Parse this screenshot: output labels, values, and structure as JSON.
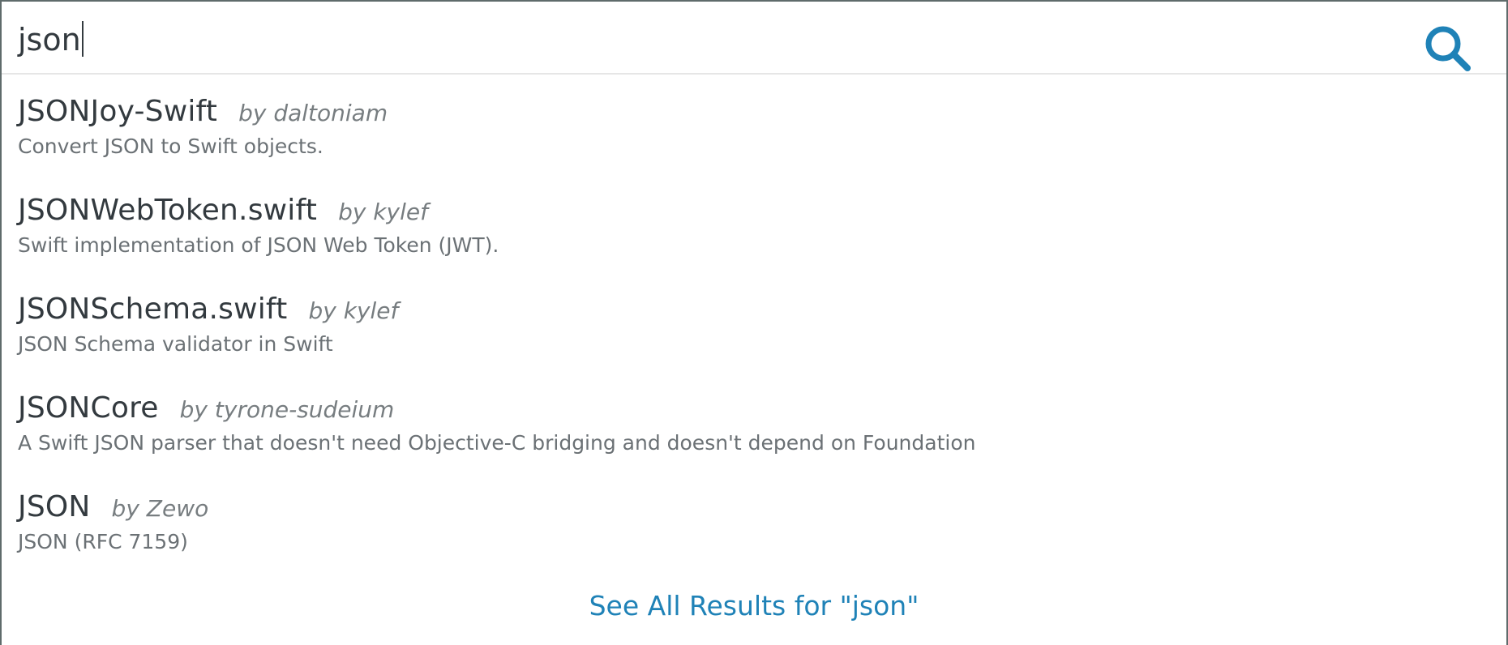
{
  "search": {
    "query": "json",
    "accent_color": "#1f82b7"
  },
  "results": [
    {
      "name": "JSONJoy-Swift",
      "author": "by daltoniam",
      "description": "Convert JSON to Swift objects."
    },
    {
      "name": "JSONWebToken.swift",
      "author": "by kylef",
      "description": "Swift implementation of JSON Web Token (JWT)."
    },
    {
      "name": "JSONSchema.swift",
      "author": "by kylef",
      "description": "JSON Schema validator in Swift"
    },
    {
      "name": "JSONCore",
      "author": "by tyrone-sudeium",
      "description": "A Swift JSON parser that doesn't need Objective-C bridging and doesn't depend on Foundation"
    },
    {
      "name": "JSON",
      "author": "by Zewo",
      "description": "JSON (RFC 7159)"
    }
  ],
  "see_all_label": "See All Results for \"json\"",
  "icons": {
    "search": "search-icon"
  }
}
